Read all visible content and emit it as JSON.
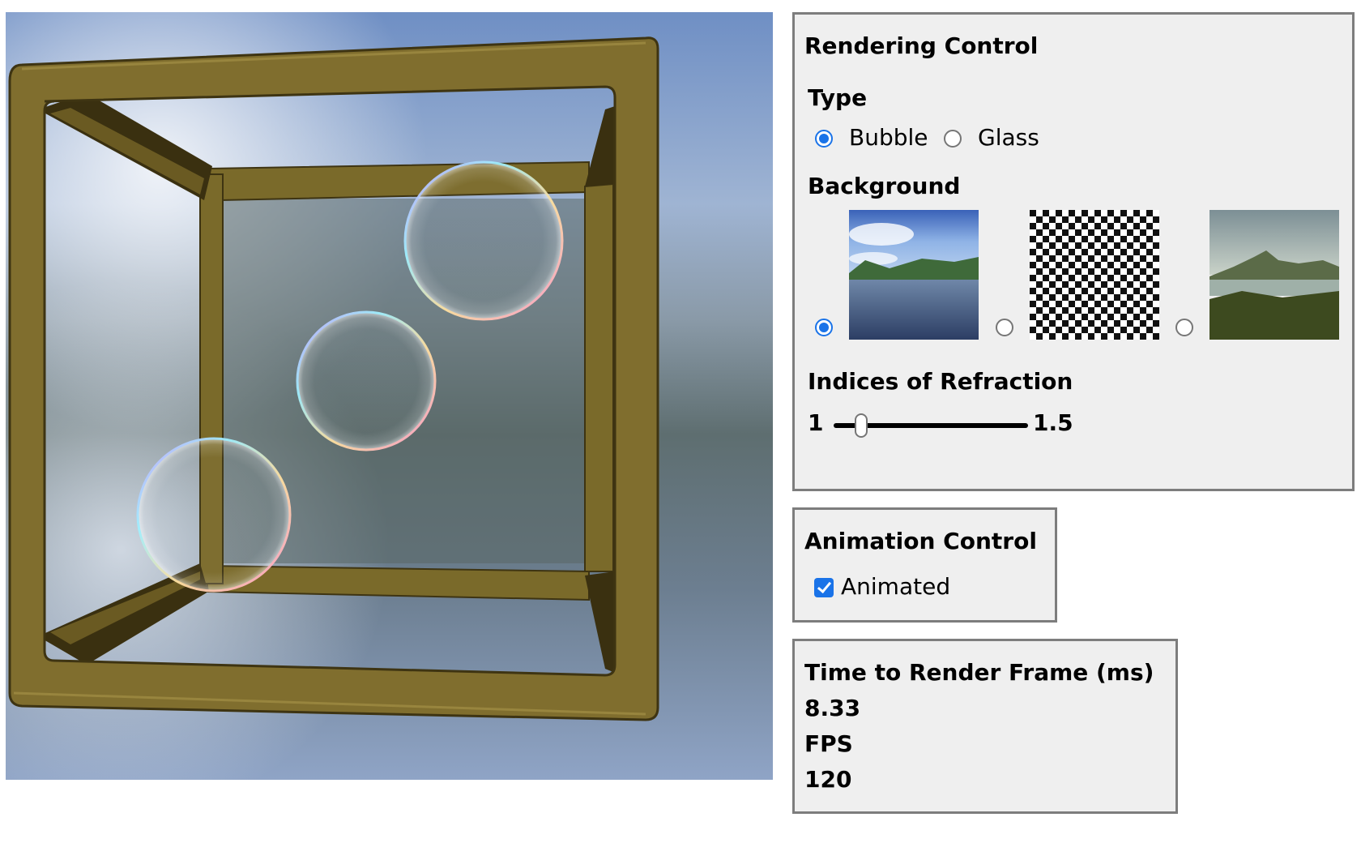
{
  "rendering_control": {
    "title": "Rendering Control",
    "type_label": "Type",
    "type_options": [
      "Bubble",
      "Glass"
    ],
    "type_selected": "Bubble",
    "background_label": "Background",
    "background_options": [
      "sky-and-lake",
      "checkerboard",
      "mountains"
    ],
    "background_selected": "sky-and-lake",
    "refraction_label": "Indices of Refraction",
    "refraction_min": "1",
    "refraction_max": "1.5",
    "refraction_value_fraction": 0.14
  },
  "animation_control": {
    "title": "Animation Control",
    "animated_label": "Animated",
    "animated_checked": true
  },
  "stats": {
    "time_label": "Time to Render Frame (ms)",
    "time_value": "8.33",
    "fps_label": "FPS",
    "fps_value": "120"
  },
  "colors": {
    "frame": "#7a6a2a",
    "accent": "#1a73e8",
    "panel_bg": "#efefef",
    "panel_border": "#7d7d7d"
  }
}
